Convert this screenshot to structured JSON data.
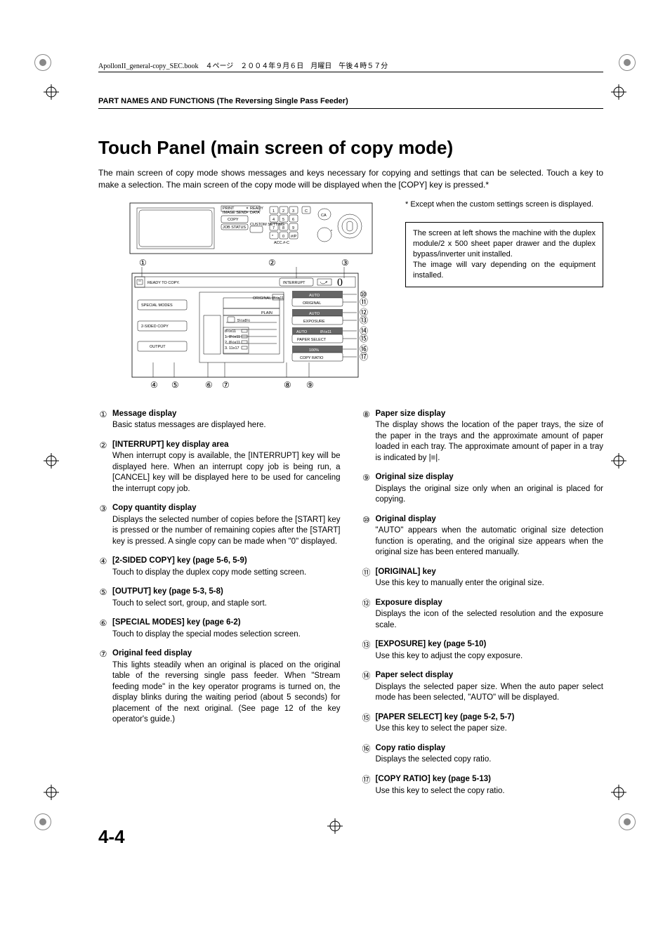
{
  "book_header": "ApollonII_general-copy_SEC.book　４ページ　２００４年９月６日　月曜日　午後４時５７分",
  "section_head": "PART NAMES AND FUNCTIONS (The Reversing Single Pass Feeder)",
  "title": "Touch Panel (main screen of copy mode)",
  "intro": "The main screen of copy mode shows messages and keys necessary for copying and settings that can be selected. Touch a key to make a selection. The main screen of the copy mode will be displayed when the [COPY] key is pressed.*",
  "note1": "* Except when the custom settings screen is displayed.",
  "note2_a": "The screen at left shows the machine with the duplex module/2 x 500 sheet paper drawer and the duplex bypass/inverter unit installed.",
  "note2_b": "The image will vary depending on the equipment installed.",
  "svg_text": {
    "ready": "READY TO COPY.",
    "interrupt": "INTERRUPT",
    "zero": "0",
    "special": "SPECIAL MODES",
    "twosided": "2-SIDED COPY",
    "output": "OUTPUT",
    "original_lbl": "ORIGINAL",
    "plain": "PLAIN",
    "size85x11": "8½x11",
    "size55x85": "5½x8½",
    "tray0": "8½x11",
    "tray1": "8½x11",
    "tray2": "8½x11",
    "tray3": "11x17",
    "auto1": "AUTO",
    "original_key": "ORIGINAL",
    "auto2": "AUTO",
    "exposure": "EXPOSURE",
    "auto3": "AUTO",
    "papsel_val": "8½x11",
    "papersel": "PAPER SELECT",
    "pct": "100%",
    "copyratio": "COPY RATIO",
    "num1": "1",
    "num2": "2",
    "num3": "3",
    "numC": "C",
    "num4": "4",
    "num5": "5",
    "num6": "6",
    "num7": "7",
    "num8": "8",
    "num9": "9",
    "numAst": "*",
    "num0": "0",
    "numHash": "#/P",
    "ca": "CA",
    "print": "PRINT",
    "imagesend": "IMAGE SEND",
    "ready_led": "READY",
    "data_led": "DATA",
    "copy_tab": "COPY",
    "jobstatus": "JOB STATUS",
    "custom": "CUSTOM SETTING"
  },
  "items_left": [
    {
      "n": "①",
      "t": "Message display",
      "b": "Basic status messages are displayed here."
    },
    {
      "n": "②",
      "t": "[INTERRUPT] key display area",
      "b": "When interrupt copy is available, the [INTERRUPT] key will be displayed here. When an interrupt copy job is being run, a [CANCEL] key will be displayed here to be used for canceling the interrupt copy job."
    },
    {
      "n": "③",
      "t": "Copy quantity display",
      "b": "Displays the selected number of copies before the [START] key is pressed or the number of remaining copies after the [START] key is pressed. A single copy can be made when \"0\" displayed."
    },
    {
      "n": "④",
      "t": "[2-SIDED COPY] key (page 5-6, 5-9)",
      "b": "Touch to display the duplex copy mode setting screen."
    },
    {
      "n": "⑤",
      "t": "[OUTPUT] key (page 5-3, 5-8)",
      "b": "Touch to select sort, group, and staple sort."
    },
    {
      "n": "⑥",
      "t": "[SPECIAL MODES] key (page 6-2)",
      "b": "Touch to display the special modes selection screen."
    },
    {
      "n": "⑦",
      "t": "Original feed display",
      "b": "This lights steadily when an original is placed on the original table of the reversing single pass feeder. When \"Stream feeding mode\" in the key operator programs is turned on, the display blinks during the waiting period (about 5 seconds) for placement of the next original. (See page 12 of the key operator's guide.)"
    }
  ],
  "items_right": [
    {
      "n": "⑧",
      "t": "Paper size display",
      "b": "The display shows the location of the paper trays, the size of the paper in the trays and the approximate amount of paper loaded in each tray. The approximate amount of paper in a tray is indicated by |≡|."
    },
    {
      "n": "⑨",
      "t": "Original size display",
      "b": "Displays the original size only when an original is placed for copying."
    },
    {
      "n": "⑩",
      "t": "Original display",
      "b": "\"AUTO\" appears when the automatic original size detection function is operating, and the original size appears when the original size has been entered manually."
    },
    {
      "n": "⑪",
      "t": "[ORIGINAL] key",
      "b": "Use this key to manually enter the original size."
    },
    {
      "n": "⑫",
      "t": "Exposure display",
      "b": "Displays the icon of the selected resolution and the exposure scale."
    },
    {
      "n": "⑬",
      "t": "[EXPOSURE] key (page 5-10)",
      "b": "Use this key to adjust the copy exposure."
    },
    {
      "n": "⑭",
      "t": "Paper select display",
      "b": "Displays the selected paper size. When the auto paper select mode has been selected, \"AUTO\" will be displayed."
    },
    {
      "n": "⑮",
      "t": "[PAPER SELECT] key (page 5-2, 5-7)",
      "b": "Use this key to select the paper size."
    },
    {
      "n": "⑯",
      "t": "Copy ratio display",
      "b": "Displays the selected copy ratio."
    },
    {
      "n": "⑰",
      "t": "[COPY RATIO] key (page 5-13)",
      "b": "Use this key to select the copy ratio."
    }
  ],
  "circ": [
    "①",
    "②",
    "③",
    "④",
    "⑤",
    "⑥",
    "⑦",
    "⑧",
    "⑨",
    "⑩",
    "⑪",
    "⑫",
    "⑬",
    "⑭",
    "⑮",
    "⑯",
    "⑰"
  ],
  "page_num": "4-4"
}
